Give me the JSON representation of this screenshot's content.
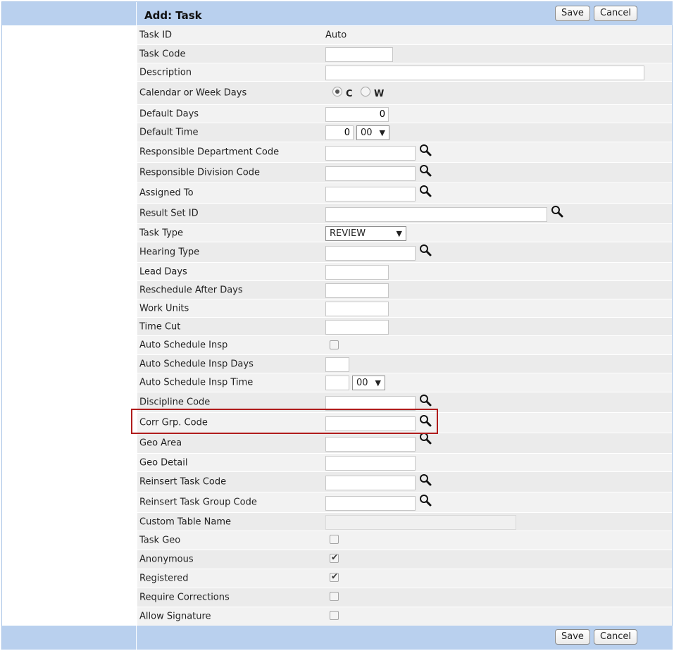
{
  "header": {
    "title": "Add: Task",
    "save_label": "Save",
    "cancel_label": "Cancel"
  },
  "footer": {
    "save_label": "Save",
    "cancel_label": "Cancel"
  },
  "fields": {
    "task_id": {
      "label": "Task ID",
      "value": "Auto"
    },
    "task_code": {
      "label": "Task Code",
      "value": ""
    },
    "description": {
      "label": "Description",
      "value": ""
    },
    "calendar_or_week_days": {
      "label": "Calendar or Week Days",
      "option_c": "C",
      "option_w": "W",
      "selected": "C"
    },
    "default_days": {
      "label": "Default Days",
      "value": "0"
    },
    "default_time": {
      "label": "Default Time",
      "hours": "0",
      "minutes": "00"
    },
    "responsible_department_code": {
      "label": "Responsible Department Code",
      "value": ""
    },
    "responsible_division_code": {
      "label": "Responsible Division Code",
      "value": ""
    },
    "assigned_to": {
      "label": "Assigned To",
      "value": ""
    },
    "result_set_id": {
      "label": "Result Set ID",
      "value": ""
    },
    "task_type": {
      "label": "Task Type",
      "value": "REVIEW"
    },
    "hearing_type": {
      "label": "Hearing Type",
      "value": ""
    },
    "lead_days": {
      "label": "Lead Days",
      "value": ""
    },
    "reschedule_after_days": {
      "label": "Reschedule After Days",
      "value": ""
    },
    "work_units": {
      "label": "Work Units",
      "value": ""
    },
    "time_cut": {
      "label": "Time Cut",
      "value": ""
    },
    "auto_schedule_insp": {
      "label": "Auto Schedule Insp",
      "checked": false
    },
    "auto_schedule_insp_days": {
      "label": "Auto Schedule Insp Days",
      "value": ""
    },
    "auto_schedule_insp_time": {
      "label": "Auto Schedule Insp Time",
      "hours": "",
      "minutes": "00"
    },
    "discipline_code": {
      "label": "Discipline Code",
      "value": ""
    },
    "corr_grp_code": {
      "label": "Corr Grp. Code",
      "value": ""
    },
    "geo_area": {
      "label": "Geo Area",
      "value": ""
    },
    "geo_detail": {
      "label": "Geo Detail",
      "value": ""
    },
    "reinsert_task_code": {
      "label": "Reinsert Task Code",
      "value": ""
    },
    "reinsert_task_group_code": {
      "label": "Reinsert Task Group Code",
      "value": ""
    },
    "custom_table_name": {
      "label": "Custom Table Name",
      "value": ""
    },
    "task_geo": {
      "label": "Task Geo",
      "checked": false
    },
    "anonymous": {
      "label": "Anonymous",
      "checked": true
    },
    "registered": {
      "label": "Registered",
      "checked": true
    },
    "require_corrections": {
      "label": "Require Corrections",
      "checked": false
    },
    "allow_signature": {
      "label": "Allow Signature",
      "checked": false
    }
  },
  "icons": {
    "lookup": "magnifier-icon",
    "dropdown": "triangle-down-icon"
  },
  "colors": {
    "header_bar": "#b9d0ee",
    "highlight_border": "#b01c1c"
  }
}
